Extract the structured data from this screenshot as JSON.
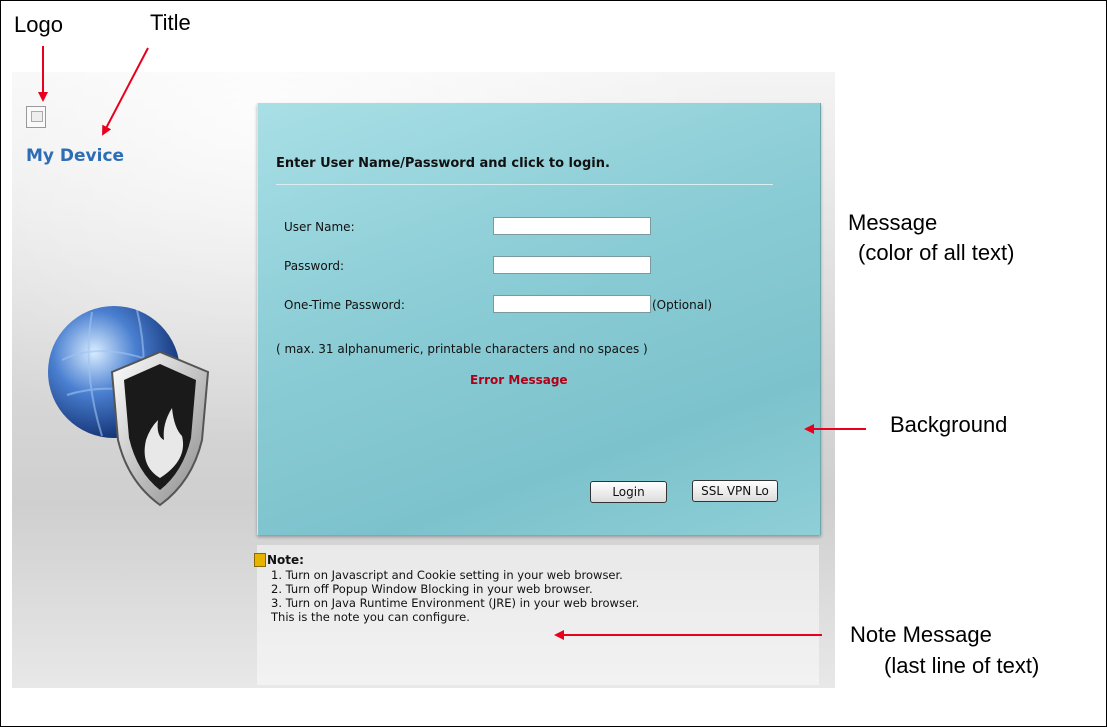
{
  "annotations": {
    "logo": "Logo",
    "title": "Title",
    "message_line1": "Message",
    "message_line2": "(color of all text)",
    "background": "Background",
    "note_line1": "Note Message",
    "note_line2": "(last line of text)"
  },
  "header": {
    "title": "My Device"
  },
  "login": {
    "heading": "Enter User Name/Password and click to login.",
    "username_label": "User Name:",
    "password_label": "Password:",
    "otp_label": "One-Time Password:",
    "otp_optional": "(Optional)",
    "username_value": "",
    "password_value": "",
    "otp_value": "",
    "hint": "( max. 31 alphanumeric, printable characters and no spaces )",
    "error": "Error Message",
    "login_button": "Login",
    "ssl_button": "SSL VPN Lo"
  },
  "note": {
    "title": "Note:",
    "lines": [
      "1. Turn on Javascript and Cookie setting in your web browser.",
      "2. Turn off Popup Window Blocking in your web browser.",
      "3. Turn on Java Runtime Environment (JRE) in your web browser.",
      "This is the note you can configure."
    ]
  },
  "colors": {
    "panel": "#8ccdd6",
    "title": "#2c6db5",
    "error": "#b00018",
    "arrow": "#e8001c"
  }
}
